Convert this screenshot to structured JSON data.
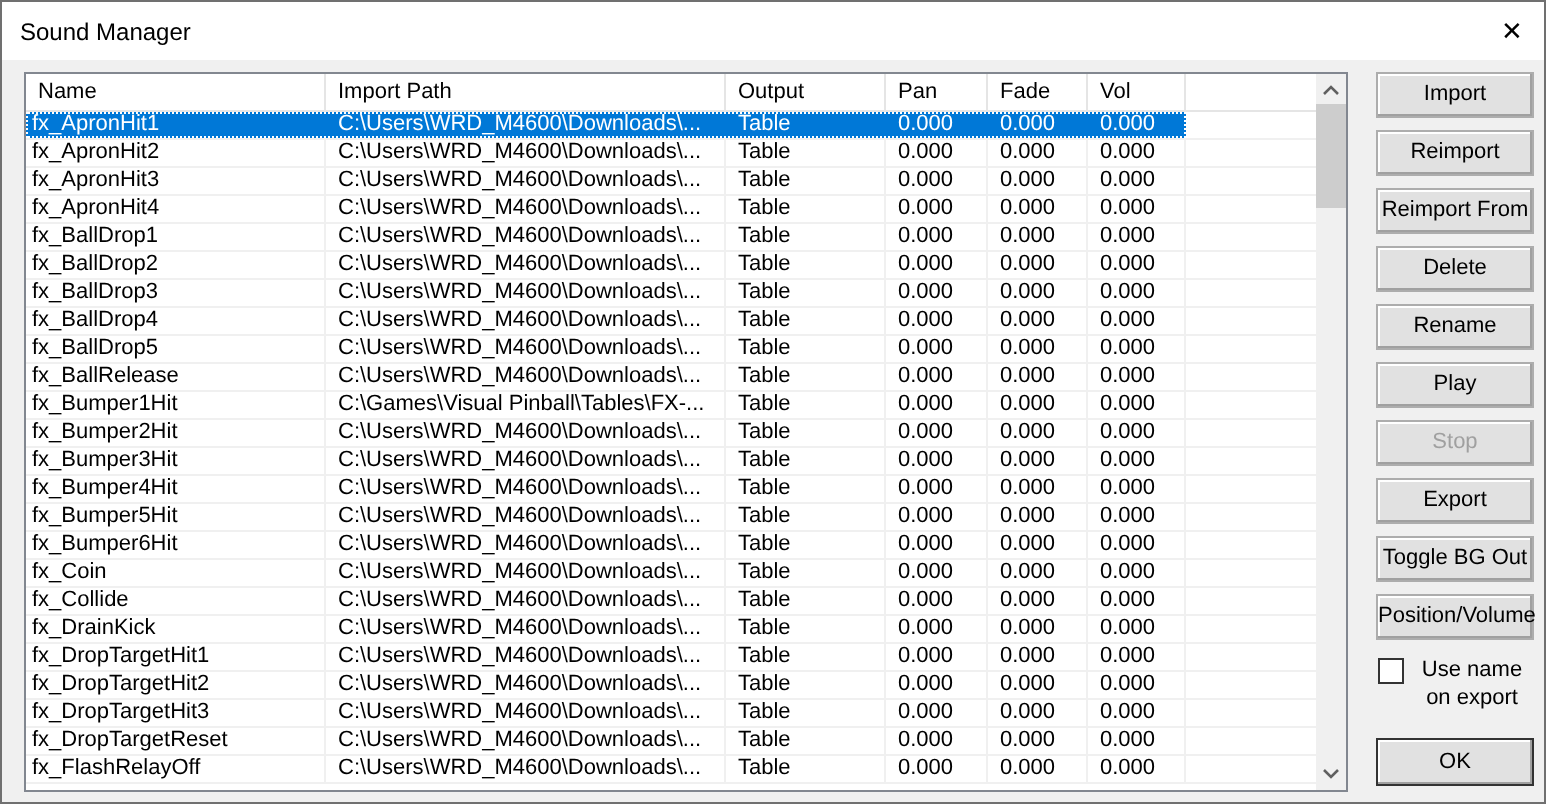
{
  "window": {
    "title": "Sound Manager",
    "close": "✕"
  },
  "table": {
    "columns": [
      "Name",
      "Import Path",
      "Output",
      "Pan",
      "Fade",
      "Vol"
    ],
    "rows": [
      {
        "cells": [
          "fx_ApronHit1",
          "C:\\Users\\WRD_M4600\\Downloads\\...",
          "Table",
          "0.000",
          "0.000",
          "0.000"
        ],
        "selected": true
      },
      {
        "cells": [
          "fx_ApronHit2",
          "C:\\Users\\WRD_M4600\\Downloads\\...",
          "Table",
          "0.000",
          "0.000",
          "0.000"
        ],
        "selected": false
      },
      {
        "cells": [
          "fx_ApronHit3",
          "C:\\Users\\WRD_M4600\\Downloads\\...",
          "Table",
          "0.000",
          "0.000",
          "0.000"
        ],
        "selected": false
      },
      {
        "cells": [
          "fx_ApronHit4",
          "C:\\Users\\WRD_M4600\\Downloads\\...",
          "Table",
          "0.000",
          "0.000",
          "0.000"
        ],
        "selected": false
      },
      {
        "cells": [
          "fx_BallDrop1",
          "C:\\Users\\WRD_M4600\\Downloads\\...",
          "Table",
          "0.000",
          "0.000",
          "0.000"
        ],
        "selected": false
      },
      {
        "cells": [
          "fx_BallDrop2",
          "C:\\Users\\WRD_M4600\\Downloads\\...",
          "Table",
          "0.000",
          "0.000",
          "0.000"
        ],
        "selected": false
      },
      {
        "cells": [
          "fx_BallDrop3",
          "C:\\Users\\WRD_M4600\\Downloads\\...",
          "Table",
          "0.000",
          "0.000",
          "0.000"
        ],
        "selected": false
      },
      {
        "cells": [
          "fx_BallDrop4",
          "C:\\Users\\WRD_M4600\\Downloads\\...",
          "Table",
          "0.000",
          "0.000",
          "0.000"
        ],
        "selected": false
      },
      {
        "cells": [
          "fx_BallDrop5",
          "C:\\Users\\WRD_M4600\\Downloads\\...",
          "Table",
          "0.000",
          "0.000",
          "0.000"
        ],
        "selected": false
      },
      {
        "cells": [
          "fx_BallRelease",
          "C:\\Users\\WRD_M4600\\Downloads\\...",
          "Table",
          "0.000",
          "0.000",
          "0.000"
        ],
        "selected": false
      },
      {
        "cells": [
          "fx_Bumper1Hit",
          "C:\\Games\\Visual Pinball\\Tables\\FX-...",
          "Table",
          "0.000",
          "0.000",
          "0.000"
        ],
        "selected": false
      },
      {
        "cells": [
          "fx_Bumper2Hit",
          "C:\\Users\\WRD_M4600\\Downloads\\...",
          "Table",
          "0.000",
          "0.000",
          "0.000"
        ],
        "selected": false
      },
      {
        "cells": [
          "fx_Bumper3Hit",
          "C:\\Users\\WRD_M4600\\Downloads\\...",
          "Table",
          "0.000",
          "0.000",
          "0.000"
        ],
        "selected": false
      },
      {
        "cells": [
          "fx_Bumper4Hit",
          "C:\\Users\\WRD_M4600\\Downloads\\...",
          "Table",
          "0.000",
          "0.000",
          "0.000"
        ],
        "selected": false
      },
      {
        "cells": [
          "fx_Bumper5Hit",
          "C:\\Users\\WRD_M4600\\Downloads\\...",
          "Table",
          "0.000",
          "0.000",
          "0.000"
        ],
        "selected": false
      },
      {
        "cells": [
          "fx_Bumper6Hit",
          "C:\\Users\\WRD_M4600\\Downloads\\...",
          "Table",
          "0.000",
          "0.000",
          "0.000"
        ],
        "selected": false
      },
      {
        "cells": [
          "fx_Coin",
          "C:\\Users\\WRD_M4600\\Downloads\\...",
          "Table",
          "0.000",
          "0.000",
          "0.000"
        ],
        "selected": false
      },
      {
        "cells": [
          "fx_Collide",
          "C:\\Users\\WRD_M4600\\Downloads\\...",
          "Table",
          "0.000",
          "0.000",
          "0.000"
        ],
        "selected": false
      },
      {
        "cells": [
          "fx_DrainKick",
          "C:\\Users\\WRD_M4600\\Downloads\\...",
          "Table",
          "0.000",
          "0.000",
          "0.000"
        ],
        "selected": false
      },
      {
        "cells": [
          "fx_DropTargetHit1",
          "C:\\Users\\WRD_M4600\\Downloads\\...",
          "Table",
          "0.000",
          "0.000",
          "0.000"
        ],
        "selected": false
      },
      {
        "cells": [
          "fx_DropTargetHit2",
          "C:\\Users\\WRD_M4600\\Downloads\\...",
          "Table",
          "0.000",
          "0.000",
          "0.000"
        ],
        "selected": false
      },
      {
        "cells": [
          "fx_DropTargetHit3",
          "C:\\Users\\WRD_M4600\\Downloads\\...",
          "Table",
          "0.000",
          "0.000",
          "0.000"
        ],
        "selected": false
      },
      {
        "cells": [
          "fx_DropTargetReset",
          "C:\\Users\\WRD_M4600\\Downloads\\...",
          "Table",
          "0.000",
          "0.000",
          "0.000"
        ],
        "selected": false
      },
      {
        "cells": [
          "fx_FlashRelayOff",
          "C:\\Users\\WRD_M4600\\Downloads\\...",
          "Table",
          "0.000",
          "0.000",
          "0.000"
        ],
        "selected": false
      }
    ]
  },
  "buttons": [
    {
      "label": "Import",
      "disabled": false
    },
    {
      "label": "Reimport",
      "disabled": false
    },
    {
      "label": "Reimport From",
      "disabled": false
    },
    {
      "label": "Delete",
      "disabled": false
    },
    {
      "label": "Rename",
      "disabled": false
    },
    {
      "label": "Play",
      "disabled": false
    },
    {
      "label": "Stop",
      "disabled": true
    },
    {
      "label": "Export",
      "disabled": false
    },
    {
      "label": "Toggle BG Out",
      "disabled": false
    },
    {
      "label": "Position/Volume",
      "disabled": false
    }
  ],
  "use_name_on_export": {
    "label": "Use name on export",
    "checked": false
  },
  "ok_button": "OK"
}
